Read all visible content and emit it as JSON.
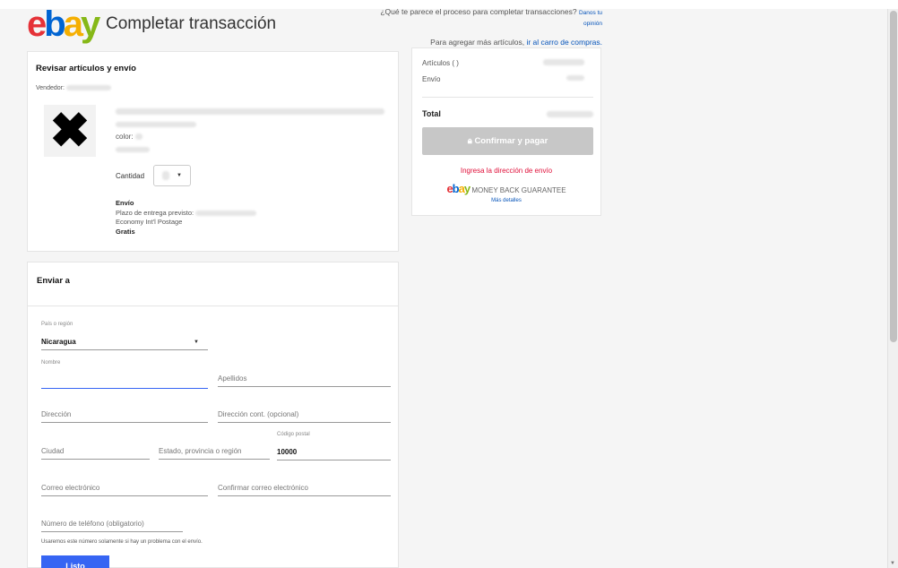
{
  "header": {
    "logo": {
      "e": "e",
      "b": "b",
      "a": "a",
      "y": "y"
    },
    "title": "Completar transacción",
    "feedback_text": "¿Qué te parece el proceso para completar transacciones?",
    "feedback_link": "Danos tu opinión",
    "cart_text": "Para agregar más artículos,",
    "cart_link": "ir al carro de compras."
  },
  "review": {
    "heading": "Revisar artículos y envío",
    "seller_label": "Vendedor:",
    "color_label": "color:",
    "quantity_label": "Cantidad",
    "shipping_heading": "Envío",
    "delivery_label": "Plazo de entrega previsto:",
    "shipping_method": "Economy Int'l Postage",
    "shipping_price": "Gratis"
  },
  "ship_to": {
    "heading": "Enviar a",
    "country_label": "País o región",
    "country_value": "Nicaragua",
    "first_name": "Nombre",
    "last_name": "Apellidos",
    "address": "Dirección",
    "address2": "Dirección cont. (opcional)",
    "city": "Ciudad",
    "state": "Estado, provincia o región",
    "postal_label": "Código postal",
    "postal_value": "10000",
    "email": "Correo electrónico",
    "email_confirm": "Confirmar correo electrónico",
    "phone": "Número de teléfono (obligatorio)",
    "phone_note": "Usaremos este número solamente si hay un problema con el envío.",
    "done_button": "Listo"
  },
  "summary": {
    "items_label": "Artículos ( )",
    "shipping_label": "Envío",
    "total_label": "Total",
    "confirm_button": "Confirmar y pagar",
    "address_warning": "Ingresa la dirección de envío",
    "mbg_text": "MONEY BACK GUARANTEE",
    "more_details": "Más detalles"
  },
  "icons": {
    "lock": "lock-icon",
    "remove": "x-icon",
    "caret": "chevron-down-icon"
  },
  "colors": {
    "accent": "#3665f3",
    "warning": "#e0103a",
    "link": "#0654ba",
    "disabled_button": "#c7c7c7"
  }
}
